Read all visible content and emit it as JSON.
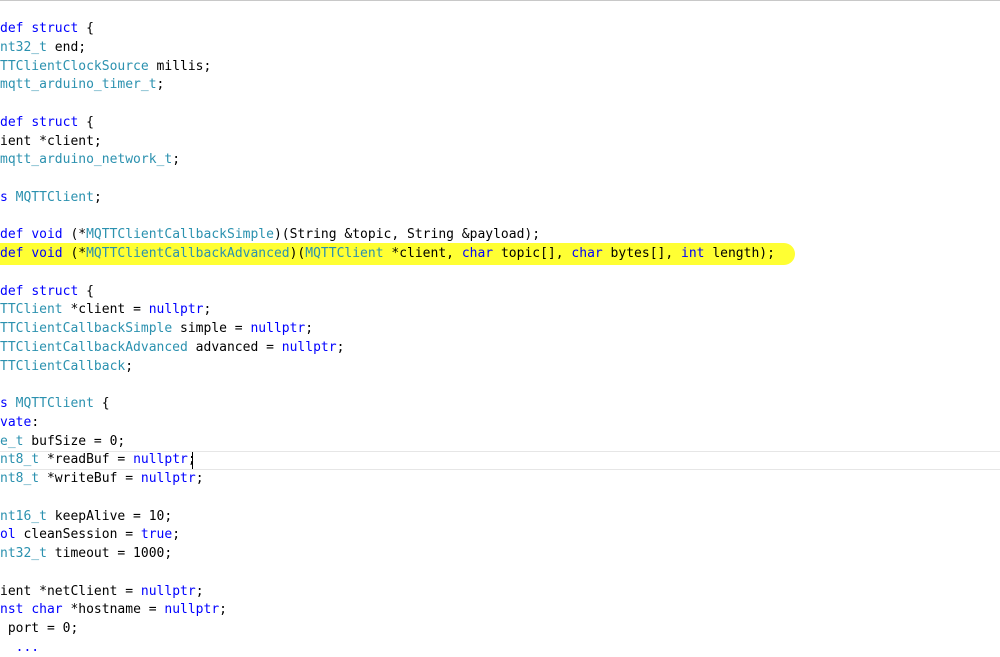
{
  "editor": {
    "lines": [
      [
        {
          "t": "def ",
          "c": "kw"
        },
        {
          "t": "struct",
          "c": "kw"
        },
        {
          "t": " {"
        }
      ],
      [
        {
          "t": "nt32_t",
          "c": "ty"
        },
        {
          "t": " end;"
        }
      ],
      [
        {
          "t": "TTClientClockSource",
          "c": "ty"
        },
        {
          "t": " millis;"
        }
      ],
      [
        {
          "t": "mqtt_arduino_timer_t",
          "c": "ty"
        },
        {
          "t": ";"
        }
      ],
      [],
      [
        {
          "t": "def ",
          "c": "kw"
        },
        {
          "t": "struct",
          "c": "kw"
        },
        {
          "t": " {"
        }
      ],
      [
        {
          "t": "ient *client;"
        }
      ],
      [
        {
          "t": "mqtt_arduino_network_t",
          "c": "ty"
        },
        {
          "t": ";"
        }
      ],
      [],
      [
        {
          "t": "s ",
          "c": "kw"
        },
        {
          "t": "MQTTClient",
          "c": "ty"
        },
        {
          "t": ";"
        }
      ],
      [],
      [
        {
          "t": "def ",
          "c": "kw"
        },
        {
          "t": "void",
          "c": "kw"
        },
        {
          "t": " (*"
        },
        {
          "t": "MQTTClientCallbackSimple",
          "c": "ty"
        },
        {
          "t": ")(String &topic, String &payload);"
        }
      ],
      [
        {
          "t": "def ",
          "c": "kw"
        },
        {
          "t": "void",
          "c": "kw"
        },
        {
          "t": " (*"
        },
        {
          "t": "MQTTClientCallbackAdvanced",
          "c": "ty"
        },
        {
          "t": ")("
        },
        {
          "t": "MQTTClient",
          "c": "ty"
        },
        {
          "t": " *client, "
        },
        {
          "t": "char",
          "c": "kw"
        },
        {
          "t": " topic[], "
        },
        {
          "t": "char",
          "c": "kw"
        },
        {
          "t": " bytes[], "
        },
        {
          "t": "int",
          "c": "kw"
        },
        {
          "t": " length);"
        }
      ],
      [],
      [
        {
          "t": "def ",
          "c": "kw"
        },
        {
          "t": "struct",
          "c": "kw"
        },
        {
          "t": " {"
        }
      ],
      [
        {
          "t": "TTClient",
          "c": "ty"
        },
        {
          "t": " *client = "
        },
        {
          "t": "nullptr",
          "c": "kw"
        },
        {
          "t": ";"
        }
      ],
      [
        {
          "t": "TTClientCallbackSimple",
          "c": "ty"
        },
        {
          "t": " simple = "
        },
        {
          "t": "nullptr",
          "c": "kw"
        },
        {
          "t": ";"
        }
      ],
      [
        {
          "t": "TTClientCallbackAdvanced",
          "c": "ty"
        },
        {
          "t": " advanced = "
        },
        {
          "t": "nullptr",
          "c": "kw"
        },
        {
          "t": ";"
        }
      ],
      [
        {
          "t": "TTClientCallback",
          "c": "ty"
        },
        {
          "t": ";"
        }
      ],
      [],
      [
        {
          "t": "s ",
          "c": "kw"
        },
        {
          "t": "MQTTClient",
          "c": "ty"
        },
        {
          "t": " {"
        }
      ],
      [
        {
          "t": "vate",
          "c": "kw"
        },
        {
          "t": ":"
        }
      ],
      [
        {
          "t": "e_t",
          "c": "ty"
        },
        {
          "t": " bufSize = 0;"
        }
      ],
      [
        {
          "t": "nt8_t",
          "c": "ty"
        },
        {
          "t": " *readBuf = "
        },
        {
          "t": "nullptr",
          "c": "kw"
        },
        {
          "t": ";"
        }
      ],
      [
        {
          "t": "nt8_t",
          "c": "ty"
        },
        {
          "t": " *writeBuf = "
        },
        {
          "t": "nullptr",
          "c": "kw"
        },
        {
          "t": ";"
        }
      ],
      [],
      [
        {
          "t": "nt16_t",
          "c": "ty"
        },
        {
          "t": " keepAlive = 10;"
        }
      ],
      [
        {
          "t": "ol",
          "c": "kw"
        },
        {
          "t": " cleanSession = "
        },
        {
          "t": "true",
          "c": "kw"
        },
        {
          "t": ";"
        }
      ],
      [
        {
          "t": "nt32_t",
          "c": "ty"
        },
        {
          "t": " timeout = 1000;"
        }
      ],
      [],
      [
        {
          "t": "ient *netClient = "
        },
        {
          "t": "nullptr",
          "c": "kw"
        },
        {
          "t": ";"
        }
      ],
      [
        {
          "t": "nst ",
          "c": "kw"
        },
        {
          "t": "char",
          "c": "kw"
        },
        {
          "t": " *hostname = "
        },
        {
          "t": "nullptr",
          "c": "kw"
        },
        {
          "t": ";"
        }
      ],
      [
        {
          "t": " port = 0;"
        }
      ],
      [
        {
          "t": "  "
        },
        {
          "t": "...",
          "c": "kw"
        }
      ]
    ]
  }
}
